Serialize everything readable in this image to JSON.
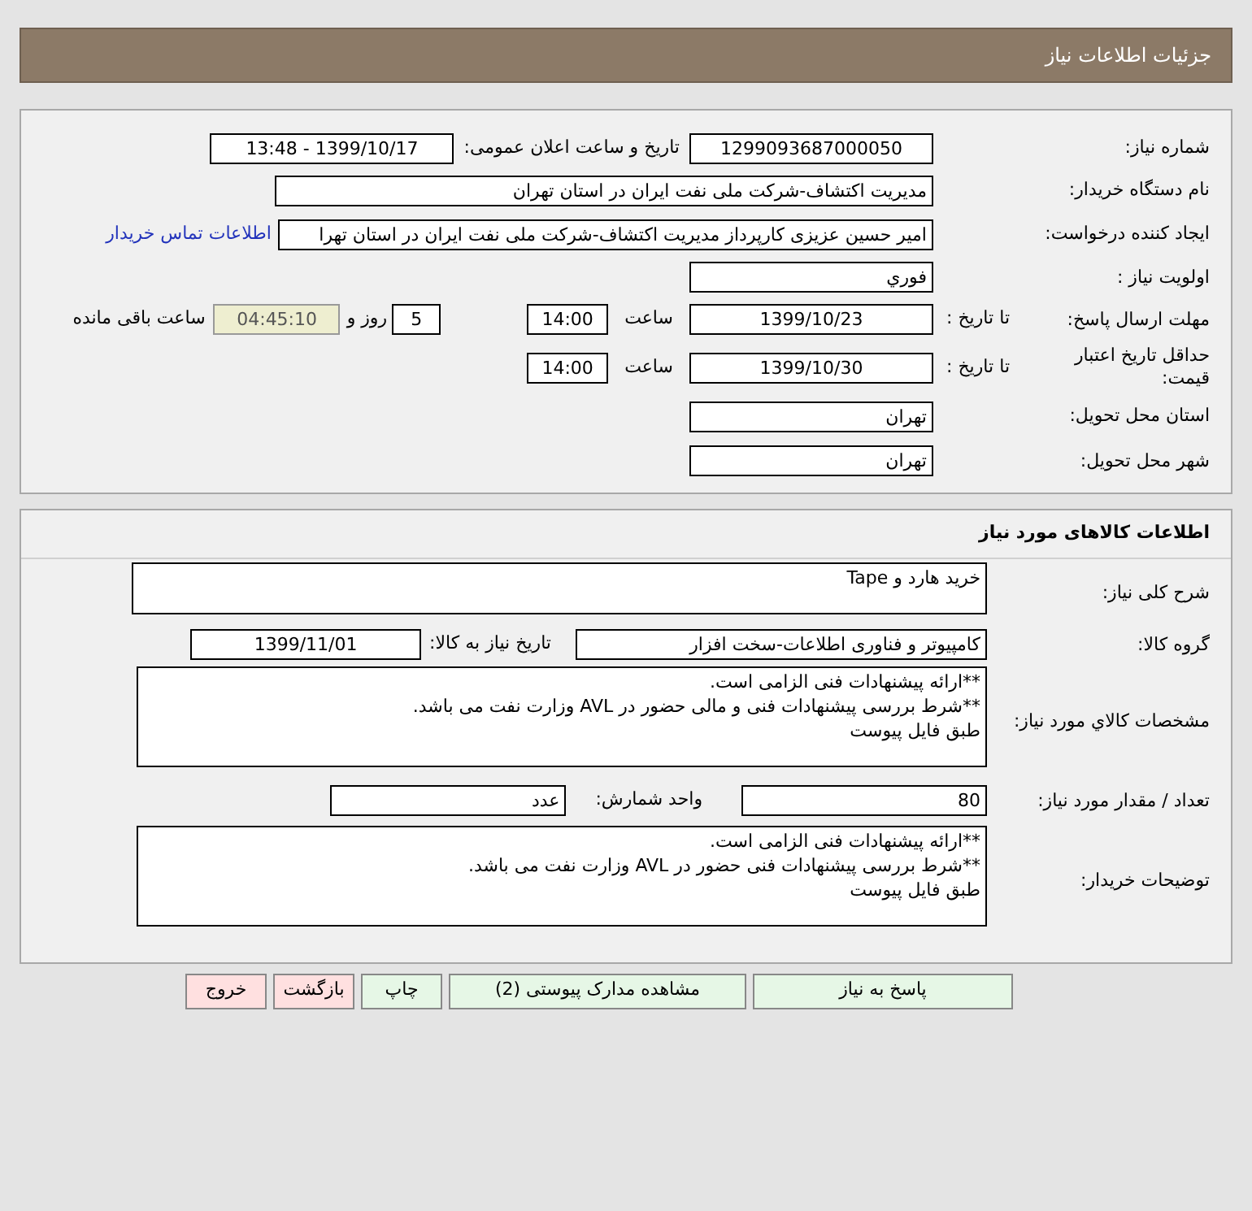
{
  "header": {
    "title": "جزئیات اطلاعات نیاز"
  },
  "request": {
    "rows": [
      {
        "label": "شماره نیاز:",
        "items": [
          {
            "kind": "field",
            "text": "1299093687000050"
          },
          {
            "kind": "label",
            "text": "تاریخ و ساعت اعلان عمومی:"
          },
          {
            "kind": "field",
            "text": "1399/10/17 - 13:48"
          }
        ]
      },
      {
        "label": "نام دستگاه خریدار:",
        "items": [
          {
            "kind": "field",
            "text": "مدیریت اکتشاف-شرکت ملی نفت ایران در استان تهران"
          }
        ]
      },
      {
        "label": "ایجاد کننده درخواست:",
        "items": [
          {
            "kind": "field",
            "text": "امیر حسین عزیزی کارپرداز مدیریت اکتشاف-شرکت ملی نفت ایران در استان تهرا"
          },
          {
            "kind": "link",
            "text": "اطلاعات تماس خریدار"
          }
        ]
      },
      {
        "label": "اولویت نیاز :",
        "items": [
          {
            "kind": "field",
            "text": "فوري"
          }
        ]
      },
      {
        "label": "مهلت ارسال پاسخ:",
        "sublabel": "تا تاریخ :",
        "items": [
          {
            "kind": "field",
            "text": "1399/10/23"
          },
          {
            "kind": "label",
            "text": "ساعت"
          },
          {
            "kind": "field",
            "text": "14:00"
          },
          {
            "kind": "field",
            "text": "5"
          },
          {
            "kind": "label",
            "text": "روز و"
          },
          {
            "kind": "timer",
            "text": "04:45:10"
          },
          {
            "kind": "label",
            "text": "ساعت باقی مانده"
          }
        ]
      },
      {
        "label": "حداقل تاریخ اعتبار قیمت:",
        "sublabel": "تا تاریخ :",
        "items": [
          {
            "kind": "field",
            "text": "1399/10/30"
          },
          {
            "kind": "label",
            "text": "ساعت"
          },
          {
            "kind": "field",
            "text": "14:00"
          }
        ]
      },
      {
        "label": "استان محل تحویل:",
        "items": [
          {
            "kind": "field",
            "text": "تهران"
          }
        ]
      },
      {
        "label": "شهر محل تحویل:",
        "items": [
          {
            "kind": "field",
            "text": "تهران"
          }
        ]
      }
    ]
  },
  "goods": {
    "title": "اطلاعات کالاهای مورد نیاز",
    "rows": [
      {
        "label": "شرح کلی نیاز:",
        "items": [
          {
            "kind": "textarea",
            "lines": [
              "خرید هارد و Tape"
            ]
          }
        ]
      },
      {
        "label": "گروه کالا:",
        "items": [
          {
            "kind": "field",
            "text": "کامپیوتر و فناوری اطلاعات-سخت افزار"
          },
          {
            "kind": "label",
            "text": "تاریخ نیاز به کالا:"
          },
          {
            "kind": "field",
            "text": "1399/11/01"
          }
        ]
      },
      {
        "label": "مشخصات کالاي مورد نیاز:",
        "items": [
          {
            "kind": "textarea",
            "lines": [
              "**ارائه پیشنهادات فنی الزامی است.",
              "**شرط بررسی پیشنهادات فنی و مالی حضور در AVL وزارت نفت می باشد.",
              "طبق فایل پیوست"
            ]
          }
        ]
      },
      {
        "label": "تعداد / مقدار مورد نیاز:",
        "items": [
          {
            "kind": "field",
            "text": "80"
          },
          {
            "kind": "label",
            "text": "واحد شمارش:"
          },
          {
            "kind": "field",
            "text": "عدد"
          }
        ]
      },
      {
        "label": "توضیحات خریدار:",
        "items": [
          {
            "kind": "textarea",
            "lines": [
              "**ارائه پیشنهادات فنی الزامی است.",
              "**شرط بررسی پیشنهادات فنی حضور در AVL وزارت نفت می باشد.",
              "طبق فایل پیوست"
            ]
          }
        ]
      }
    ]
  },
  "buttons": [
    {
      "text": "پاسخ به نیاز",
      "kind": "primary"
    },
    {
      "text": "مشاهده مدارک پیوستی (2)",
      "kind": "primary"
    },
    {
      "text": "چاپ",
      "kind": "primary"
    },
    {
      "text": "بازگشت",
      "kind": "danger"
    },
    {
      "text": "خروج",
      "kind": "danger"
    }
  ]
}
